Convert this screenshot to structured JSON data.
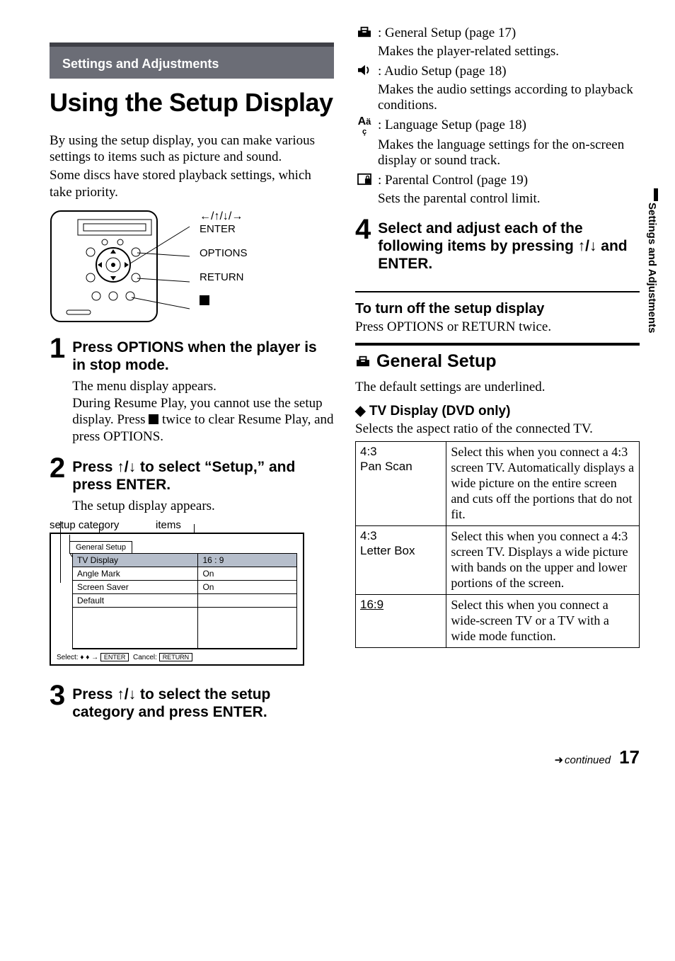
{
  "section_header": "Settings and Adjustments",
  "main_title": "Using the Setup Display",
  "intro": {
    "p1": "By using the setup display, you can make various settings to items such as picture and sound.",
    "p2": "Some discs have stored playback settings, which take priority."
  },
  "remote": {
    "directions": "←/↑/↓/→",
    "enter": "ENTER",
    "options": "OPTIONS",
    "return": "RETURN"
  },
  "steps": {
    "s1": {
      "num": "1",
      "title": "Press OPTIONS when the player is in stop mode.",
      "desc_a": "The menu display appears.",
      "desc_b": "During Resume Play, you cannot use the setup display. Press ",
      "desc_c": " twice to clear Resume Play, and press OPTIONS."
    },
    "s2": {
      "num": "2",
      "title": "Press ↑/↓ to select “Setup,” and press ENTER.",
      "desc": "The setup display appears."
    },
    "s3": {
      "num": "3",
      "title": "Press ↑/↓ to select the setup category and press ENTER."
    },
    "s4": {
      "num": "4",
      "title": "Select and adjust each of the following items by pressing ↑/↓ and ENTER."
    }
  },
  "setup_fig": {
    "label_category": "setup category",
    "label_items": "items",
    "tab": "General Setup",
    "rows": [
      {
        "name": "TV Display",
        "val": "16 : 9"
      },
      {
        "name": "Angle Mark",
        "val": "On"
      },
      {
        "name": "Screen Saver",
        "val": "On"
      },
      {
        "name": "Default",
        "val": ""
      }
    ],
    "footer_select": "Select:",
    "footer_enter": "ENTER",
    "footer_cancel": "Cancel:",
    "footer_return": "RETURN"
  },
  "icon_list": [
    {
      "name": "General Setup (page 17)",
      "desc": "Makes the player-related settings."
    },
    {
      "name": "Audio Setup (page 18)",
      "desc": "Makes the audio settings according to playback conditions."
    },
    {
      "name": "Language Setup (page 18)",
      "desc": "Makes the language settings for the on-screen display or sound track."
    },
    {
      "name": "Parental Control (page 19)",
      "desc": "Sets the parental control limit."
    }
  ],
  "turn_off": {
    "head": "To turn off the setup display",
    "body": "Press OPTIONS or RETURN twice."
  },
  "general_setup": {
    "title": "General Setup",
    "intro": "The default settings are underlined.",
    "tv_display_head": "TV Display (DVD only)",
    "tv_display_desc": "Selects the aspect ratio of the connected TV."
  },
  "tv_table": [
    {
      "name_l1": "4:3",
      "name_l2": "Pan Scan",
      "desc": "Select this when you connect a 4:3 screen TV. Automatically displays a wide picture on the entire screen and cuts off the portions that do not fit."
    },
    {
      "name_l1": "4:3",
      "name_l2": "Letter Box",
      "desc": "Select this when you connect a 4:3 screen TV. Displays a wide picture with bands on the upper and lower portions of the screen."
    },
    {
      "name_l1": "16:9",
      "name_l2": "",
      "desc": "Select this when you connect a wide-screen TV or a TV with a wide mode function."
    }
  ],
  "side_tab": "Settings and Adjustments",
  "footer": {
    "continued": "continued",
    "page": "17"
  }
}
